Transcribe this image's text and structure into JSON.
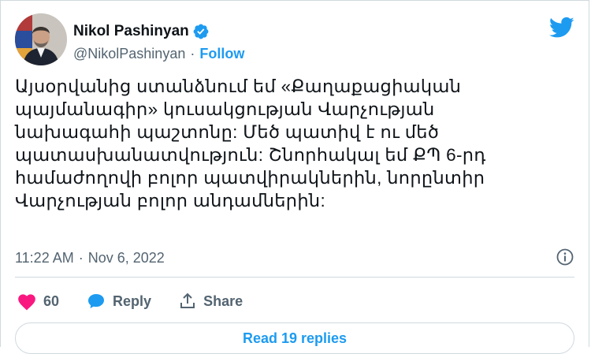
{
  "author": {
    "name": "Nikol Pashinyan",
    "handle": "@NikolPashinyan",
    "separator": "·",
    "follow_label": "Follow"
  },
  "tweet": {
    "text": "Այսօրվանից ստանձնում եմ «Քաղաքացիական\nպայմանագիր» կուսակցության Վարչության\nնախագահի պաշտոնը: Մեծ պատիվ է ու մեծ\nպատասխանատվություն: Շնորհակալ եմ ՔՊ 6-րդ\nհամաժողովի բոլոր պատվիրակներին, նորընտիր\nՎարչության բոլոր անդամներին:",
    "time": "11:22 AM",
    "separator": "·",
    "date": "Nov 6, 2022"
  },
  "actions": {
    "likes": "60",
    "reply_label": "Reply",
    "share_label": "Share"
  },
  "footer": {
    "read_replies_label": "Read 19 replies"
  },
  "icons": {
    "verified": "verified-badge-icon",
    "twitter": "twitter-bird-icon",
    "info": "info-icon",
    "like": "heart-icon",
    "reply": "speech-bubble-icon",
    "share": "share-upload-icon"
  },
  "colors": {
    "accent": "#1d9bf0",
    "like": "#f91880",
    "text": "#0f1419",
    "secondary": "#536471",
    "border": "#cfd9de"
  }
}
